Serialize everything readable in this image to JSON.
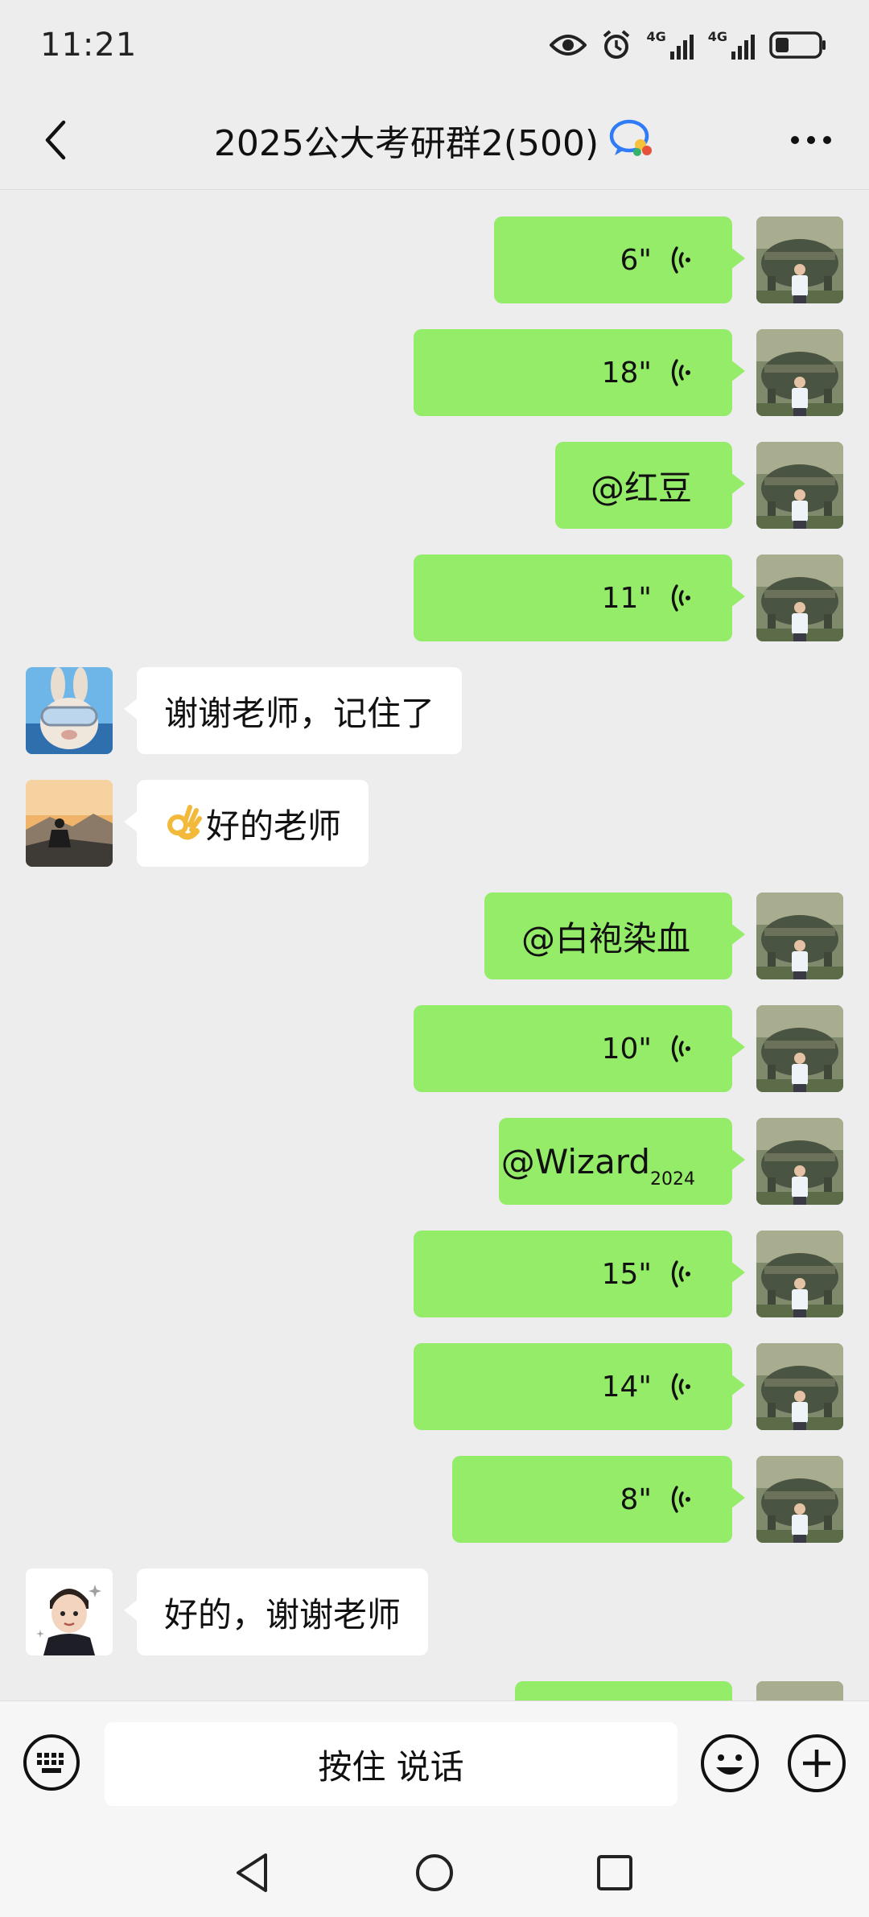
{
  "status": {
    "time": "11:21",
    "network1": "4G",
    "network2": "4G",
    "icons": [
      "eye-icon",
      "alarm-icon",
      "signal-icon",
      "signal-icon",
      "battery-icon"
    ]
  },
  "header": {
    "title": "2025公大考研群2(500)",
    "back_icon": "chevron-left-icon",
    "more_icon": "more-dots-icon",
    "badge_icon": "group-chat-badge-icon"
  },
  "messages": [
    {
      "dir": "out",
      "type": "voice",
      "duration": "6\""
    },
    {
      "dir": "out",
      "type": "voice",
      "duration": "18\""
    },
    {
      "dir": "out",
      "type": "text",
      "text": "@红豆"
    },
    {
      "dir": "out",
      "type": "voice",
      "duration": "11\""
    },
    {
      "dir": "in",
      "type": "text",
      "text": "谢谢老师，记住了"
    },
    {
      "dir": "in",
      "type": "text",
      "emoji": "ok-hand-emoji",
      "text": "好的老师"
    },
    {
      "dir": "out",
      "type": "text",
      "text": "@白袍染血"
    },
    {
      "dir": "out",
      "type": "voice",
      "duration": "10\""
    },
    {
      "dir": "out",
      "type": "mention",
      "text": "@Wizard",
      "sub": "2024"
    },
    {
      "dir": "out",
      "type": "voice",
      "duration": "15\""
    },
    {
      "dir": "out",
      "type": "voice",
      "duration": "14\""
    },
    {
      "dir": "out",
      "type": "voice",
      "duration": "8\""
    },
    {
      "dir": "in",
      "type": "text",
      "text": "好的，谢谢老师"
    }
  ],
  "input": {
    "talk_label": "按住 说话",
    "keyboard_icon": "keyboard-icon",
    "emoji_icon": "smiley-icon",
    "plus_icon": "plus-icon"
  },
  "colors": {
    "outgoing_bubble": "#95ec69",
    "incoming_bubble": "#ffffff",
    "background": "#ededed",
    "chat_badge_blue": "#2f7cf6"
  }
}
